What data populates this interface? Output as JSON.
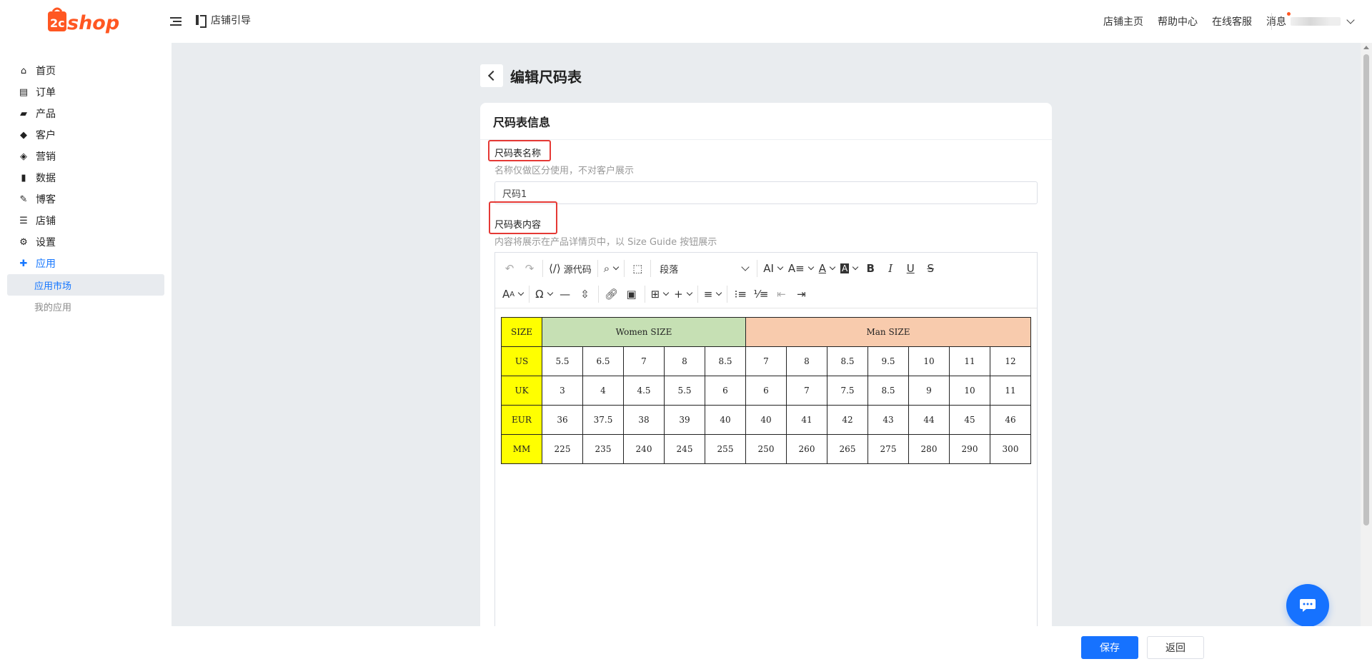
{
  "header": {
    "logo_text": "shop",
    "guide_label": "店铺引导",
    "links": [
      "店铺主页",
      "帮助中心",
      "在线客服",
      "消息"
    ],
    "user_name": "",
    "accent": "#ff5722"
  },
  "sidebar": {
    "items": [
      {
        "label": "首页",
        "icon": "home-icon"
      },
      {
        "label": "订单",
        "icon": "clipboard-icon"
      },
      {
        "label": "产品",
        "icon": "bag-icon"
      },
      {
        "label": "客户",
        "icon": "diamond-icon"
      },
      {
        "label": "营销",
        "icon": "tag-icon"
      },
      {
        "label": "数据",
        "icon": "bar-chart-icon"
      },
      {
        "label": "博客",
        "icon": "edit-icon"
      },
      {
        "label": "店铺",
        "icon": "store-icon"
      },
      {
        "label": "设置",
        "icon": "gear-icon"
      },
      {
        "label": "应用",
        "icon": "puzzle-icon"
      }
    ],
    "active_index": 9,
    "sub_items": [
      {
        "label": "应用市场",
        "active": true
      },
      {
        "label": "我的应用",
        "active": false
      }
    ]
  },
  "page": {
    "title": "编辑尺码表",
    "card_title": "尺码表信息",
    "name_label": "尺码表名称",
    "name_help": "名称仅做区分使用，不对客户展示",
    "name_value": "尺码1",
    "content_label": "尺码表内容",
    "content_help": "内容将展示在产品详情页中，以 Size Guide 按钮展示"
  },
  "toolbar": {
    "source_label": "源代码",
    "paragraph_label": "段落"
  },
  "size_table": {
    "header": {
      "size": "SIZE",
      "women": "Women  SIZE",
      "man": "Man SIZE"
    },
    "rows": [
      {
        "label": "US",
        "values": [
          "5.5",
          "6.5",
          "7",
          "8",
          "8.5",
          "7",
          "8",
          "8.5",
          "9.5",
          "10",
          "11",
          "12"
        ]
      },
      {
        "label": "UK",
        "values": [
          "3",
          "4",
          "4.5",
          "5.5",
          "6",
          "6",
          "7",
          "7.5",
          "8.5",
          "9",
          "10",
          "11"
        ]
      },
      {
        "label": "EUR",
        "values": [
          "36",
          "37.5",
          "38",
          "39",
          "40",
          "40",
          "41",
          "42",
          "43",
          "44",
          "45",
          "46"
        ]
      },
      {
        "label": "MM",
        "values": [
          "225",
          "235",
          "240",
          "245",
          "255",
          "250",
          "260",
          "265",
          "275",
          "280",
          "290",
          "300"
        ]
      }
    ],
    "colors": {
      "yellow": "#ffff00",
      "green": "#c6e0b4",
      "orange": "#f8cbad"
    }
  },
  "footer": {
    "save_label": "保存",
    "return_label": "返回",
    "primary_color": "#1672ff"
  }
}
